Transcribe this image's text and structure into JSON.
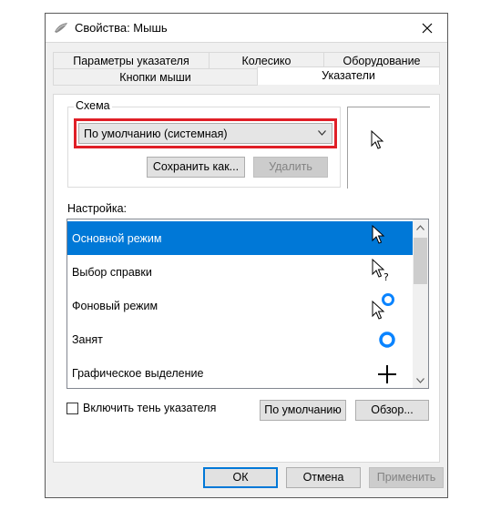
{
  "window": {
    "title": "Свойства: Мышь"
  },
  "tabs": {
    "row_back": [
      "Параметры указателя",
      "Колесико",
      "Оборудование"
    ],
    "row_front": [
      "Кнопки мыши",
      "Указатели"
    ],
    "active": "Указатели"
  },
  "scheme": {
    "group_label": "Схема",
    "selected": "По умолчанию (системная)",
    "save_button": "Сохранить как...",
    "delete_button": "Удалить"
  },
  "settings": {
    "label": "Настройка:",
    "items": [
      {
        "label": "Основной режим",
        "icon": "arrow-cursor-icon",
        "selected": true
      },
      {
        "label": "Выбор справки",
        "icon": "help-select-cursor-icon",
        "selected": false
      },
      {
        "label": "Фоновый режим",
        "icon": "working-in-background-cursor-icon",
        "selected": false
      },
      {
        "label": "Занят",
        "icon": "busy-cursor-icon",
        "selected": false
      },
      {
        "label": "Графическое выделение",
        "icon": "precision-select-cursor-icon",
        "selected": false
      }
    ]
  },
  "shadow": {
    "label": "Включить тень указателя",
    "checked": false
  },
  "buttons": {
    "use_default": "По умолчанию",
    "browse": "Обзор...",
    "ok": "ОК",
    "cancel": "Отмена",
    "apply": "Применить"
  },
  "colors": {
    "accent": "#0078d7",
    "highlight_border": "#e01f27"
  }
}
